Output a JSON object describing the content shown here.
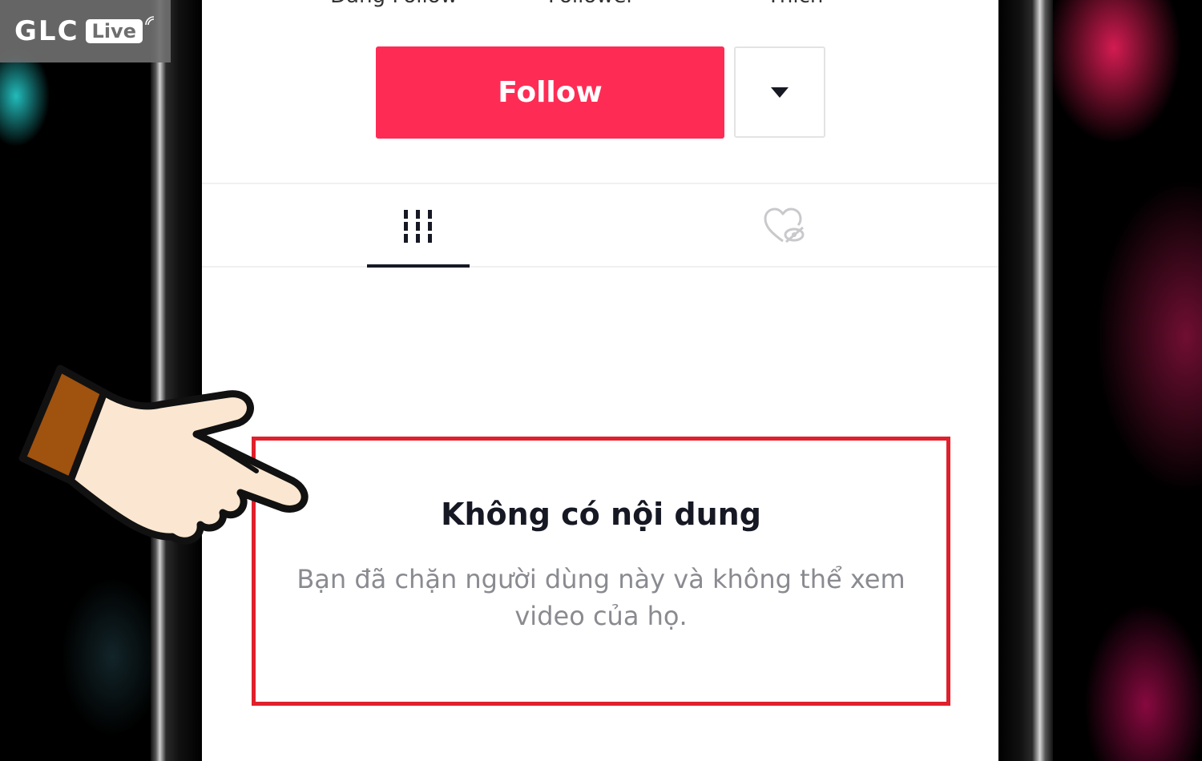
{
  "overlay": {
    "logo_brand": "GLC",
    "logo_tag": "Live"
  },
  "profile": {
    "stats": [
      {
        "label": "Đang Follow"
      },
      {
        "label": "Follower"
      },
      {
        "label": "Thích"
      }
    ],
    "follow_button_label": "Follow"
  },
  "tabs": [
    {
      "name": "videos",
      "icon": "grid-icon",
      "active": true
    },
    {
      "name": "liked",
      "icon": "hidden-heart-icon",
      "active": false
    }
  ],
  "empty_state": {
    "title": "Không có nội dung",
    "description": "Bạn đã chặn người dùng này và không thể xem video của họ."
  },
  "colors": {
    "accent": "#fe2c55",
    "highlight_border": "#e0202c"
  }
}
